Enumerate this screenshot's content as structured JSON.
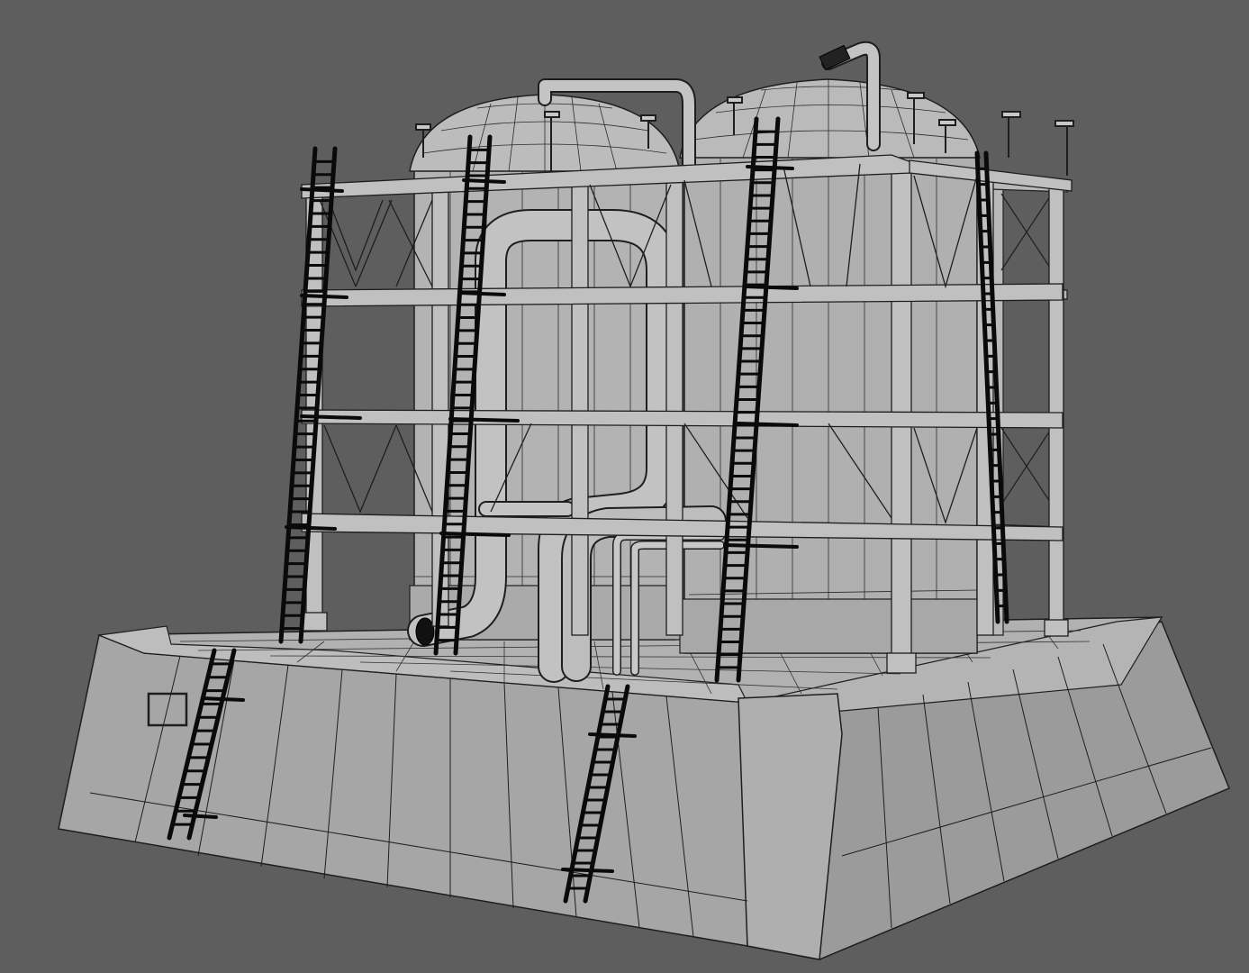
{
  "scene": {
    "background_color": "#5e5e5e",
    "model_fill": "#a9a9a9",
    "model_fill_light": "#b7b7b7",
    "model_fill_dark": "#8c8c8c",
    "wire_color": "#1e1e1e",
    "ladder_color": "#0a0a0a",
    "objects": [
      {
        "name": "concrete-base",
        "kind": "truncated-pyramid foundation"
      },
      {
        "name": "storage-tank-left",
        "kind": "domed cylinder"
      },
      {
        "name": "storage-tank-right",
        "kind": "domed cylinder"
      },
      {
        "name": "steel-frame",
        "kind": "cross-braced scaffold"
      },
      {
        "name": "pipes",
        "kind": "bent pipe runs"
      },
      {
        "name": "ladders",
        "kind": "black ladders",
        "count": 6
      }
    ]
  }
}
